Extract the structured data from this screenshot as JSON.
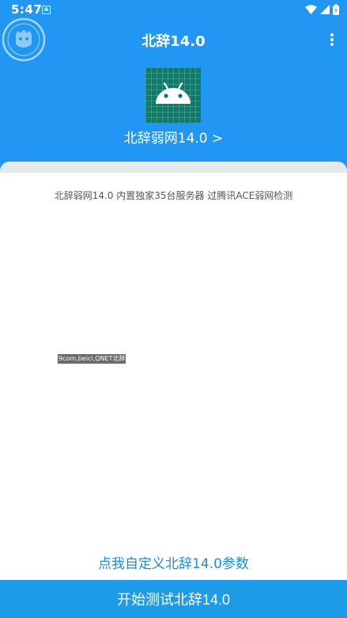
{
  "status_bar": {
    "time": "5:47",
    "notification_icon": "A",
    "icons": [
      "wifi-icon",
      "signal-icon",
      "battery-icon"
    ]
  },
  "toolbar": {
    "title": "北辞14.0",
    "menu_icon": "more-vert-icon"
  },
  "app": {
    "icon": "android-robot-icon",
    "name_link": "北辞弱网14.0 >"
  },
  "content": {
    "description": "北辞弱网14.0 内置独家35台服务器 过腾讯ACE弱网检测",
    "log_label": "9com,beici,QNET北辞",
    "custom_params_link": "点我自定义北辞14.0参数"
  },
  "actions": {
    "start_button": "开始测试北辞14.0"
  },
  "colors": {
    "primary": "#2196f3",
    "button": "#1e9be6",
    "link": "#1a8fd6",
    "icon_bg": "#0f7a68"
  }
}
